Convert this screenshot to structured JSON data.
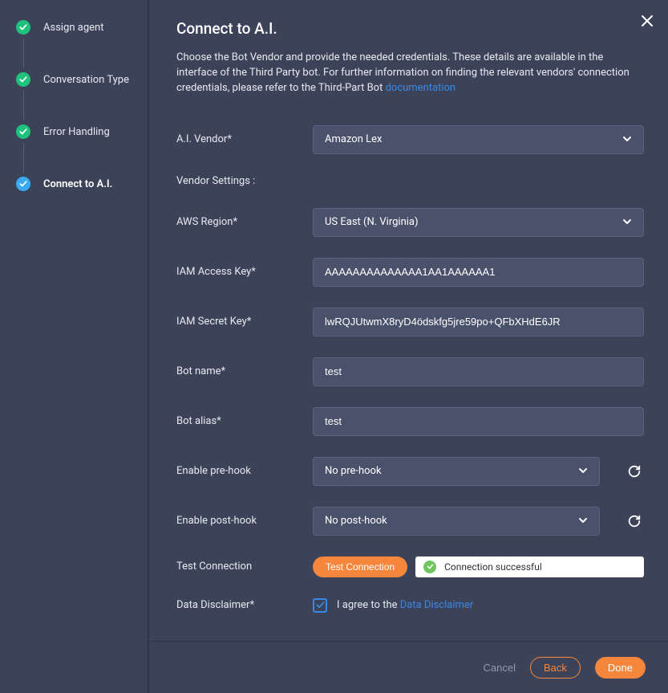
{
  "sidebar": {
    "steps": [
      {
        "label": "Assign agent",
        "state": "done"
      },
      {
        "label": "Conversation Type",
        "state": "done"
      },
      {
        "label": "Error Handling",
        "state": "done"
      },
      {
        "label": "Connect to A.I.",
        "state": "active"
      }
    ]
  },
  "header": {
    "title": "Connect to A.I.",
    "description_prefix": "Choose the Bot Vendor and provide the needed credentials. These details are available in the interface of the Third Party bot. For further information on finding the relevant vendors' connection credentials, please refer to the Third-Part Bot ",
    "doc_link_text": "documentation"
  },
  "form": {
    "ai_vendor": {
      "label": "A.I. Vendor*",
      "value": "Amazon Lex"
    },
    "vendor_settings_label": "Vendor Settings :",
    "aws_region": {
      "label": "AWS Region*",
      "value": "US East (N. Virginia)"
    },
    "iam_access_key": {
      "label": "IAM Access Key*",
      "value": "AAAAAAAAAAAAAA1AA1AAAAAA1"
    },
    "iam_secret_key": {
      "label": "IAM Secret Key*",
      "value": "lwRQJUtwmX8ryD4ödskfg5jre59po+QFbXHdE6JR"
    },
    "bot_name": {
      "label": "Bot name*",
      "value": "test"
    },
    "bot_alias": {
      "label": "Bot alias*",
      "value": "test"
    },
    "pre_hook": {
      "label": "Enable pre-hook",
      "value": "No pre-hook"
    },
    "post_hook": {
      "label": "Enable post-hook",
      "value": "No post-hook"
    },
    "test_connection": {
      "label": "Test Connection",
      "button_text": "Test Connection",
      "status_text": "Connection successful"
    },
    "disclaimer": {
      "label": "Data Disclaimer*",
      "prefix": "I agree to the ",
      "link_text": "Data Disclaimer",
      "checked": true
    }
  },
  "footer": {
    "cancel": "Cancel",
    "back": "Back",
    "done": "Done"
  },
  "colors": {
    "accent_orange": "#f5863b",
    "link_blue": "#3a88e2",
    "success": "#72c660",
    "step_done": "#1ec27c",
    "step_active": "#3aa9f0"
  }
}
